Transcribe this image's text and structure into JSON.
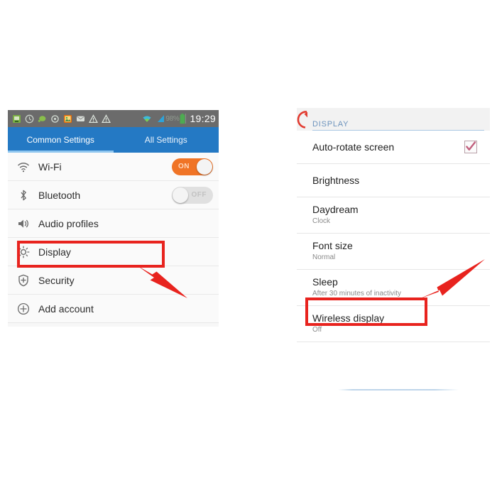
{
  "left_phone": {
    "status_bar": {
      "time": "19:29",
      "battery_percent": "98%",
      "icons": [
        "sd-card-icon",
        "clock-icon",
        "chat-bubble-icon",
        "sync-icon",
        "gallery-icon",
        "sms-icon",
        "warning-icon",
        "warning-icon",
        "wifi-icon",
        "signal-icon"
      ]
    },
    "tabs": [
      {
        "label": "Common Settings",
        "active": true
      },
      {
        "label": "All Settings",
        "active": false
      }
    ],
    "rows": [
      {
        "icon": "wifi-icon",
        "label": "Wi-Fi",
        "toggle": "ON"
      },
      {
        "icon": "bluetooth-icon",
        "label": "Bluetooth",
        "toggle": "OFF"
      },
      {
        "icon": "volume-icon",
        "label": "Audio profiles",
        "toggle": null
      },
      {
        "icon": "brightness-icon",
        "label": "Display",
        "toggle": null
      },
      {
        "icon": "shield-icon",
        "label": "Security",
        "toggle": null
      },
      {
        "icon": "plus-circle-icon",
        "label": "Add account",
        "toggle": null
      }
    ]
  },
  "right_phone": {
    "header": "DISPLAY",
    "rows": [
      {
        "title": "Auto-rotate screen",
        "subtitle": "",
        "checkbox": true
      },
      {
        "title": "Brightness",
        "subtitle": "",
        "checkbox": false
      },
      {
        "title": "Daydream",
        "subtitle": "Clock",
        "checkbox": false
      },
      {
        "title": "Font size",
        "subtitle": "Normal",
        "checkbox": false
      },
      {
        "title": "Sleep",
        "subtitle": "After 30 minutes of inactivity",
        "checkbox": false
      },
      {
        "title": "Wireless display",
        "subtitle": "Off",
        "checkbox": false
      }
    ]
  },
  "annotations": {
    "highlight_color": "#e8231e",
    "arrow_color": "#e8231e",
    "highlighted_items": [
      "Display",
      "Wireless display"
    ],
    "arrows": [
      "arrow-pointing-to-display",
      "arrow-pointing-to-wireless-display"
    ]
  },
  "colors": {
    "tab_bar": "#2479c4",
    "tab_underline": "#8fc6ef",
    "toggle_on": "#f07426",
    "toggle_off": "#e0e0e0",
    "status_bar": "#6b6b6b",
    "section_header_text": "#6c93bd"
  }
}
